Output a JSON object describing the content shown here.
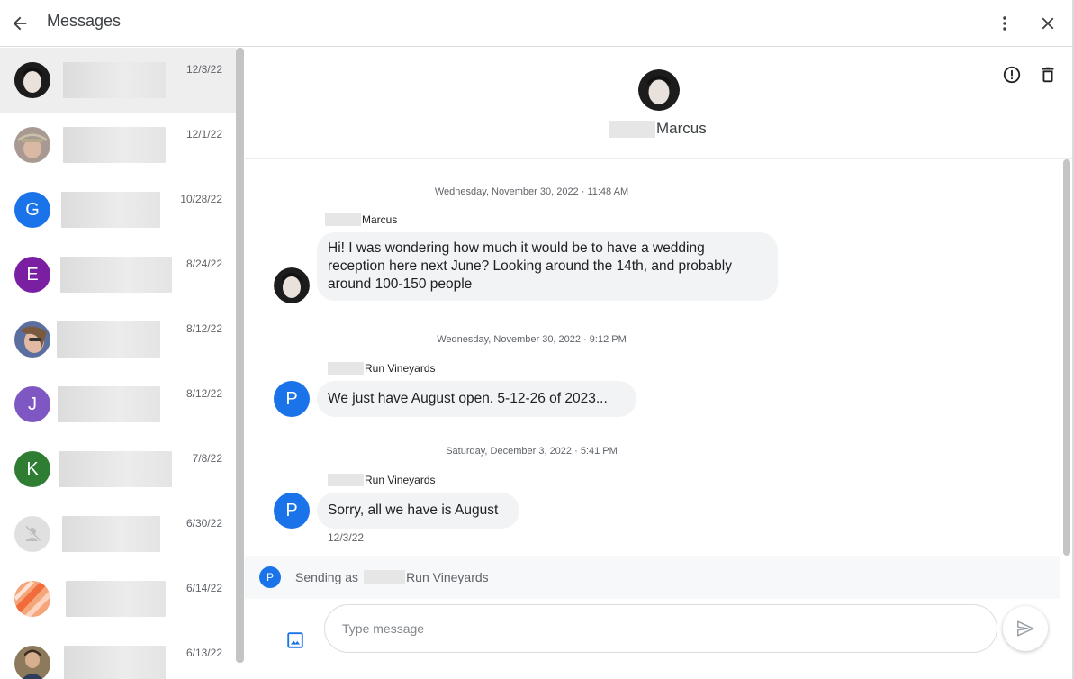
{
  "header": {
    "title": "Messages"
  },
  "conversations": [
    {
      "avatar": "photo",
      "date": "12/3/22",
      "selected": true
    },
    {
      "avatar": "photo",
      "date": "12/1/22"
    },
    {
      "avatar": "letter",
      "letter": "G",
      "color": "#1a73e8",
      "date": "10/28/22"
    },
    {
      "avatar": "letter",
      "letter": "E",
      "color": "#7b1fa2",
      "date": "8/24/22"
    },
    {
      "avatar": "photo",
      "date": "8/12/22"
    },
    {
      "avatar": "letter",
      "letter": "J",
      "color": "#7e57c2",
      "date": "8/12/22"
    },
    {
      "avatar": "letter",
      "letter": "K",
      "color": "#2e7d32",
      "date": "7/8/22"
    },
    {
      "avatar": "default",
      "date": "6/30/22"
    },
    {
      "avatar": "photo",
      "date": "6/14/22"
    },
    {
      "avatar": "photo",
      "date": "6/13/22"
    }
  ],
  "thread": {
    "contact_name": "Marcus",
    "messages": [
      {
        "timestamp": "Wednesday, November 30, 2022 · 11:48 AM",
        "sender": "Marcus",
        "lines": [
          "Hi! I was wondering how much it would be to have a wedding",
          "reception here next June? Looking around the 14th, and probably",
          "around 100-150 people"
        ]
      },
      {
        "timestamp": "Wednesday, November 30, 2022 · 9:12 PM",
        "sender": "Run Vineyards",
        "avatar_letter": "P",
        "lines": [
          "We just have August open. 5-12-26 of 2023..."
        ]
      },
      {
        "timestamp": "Saturday, December 3, 2022 · 5:41 PM",
        "sender": "Run Vineyards",
        "avatar_letter": "P",
        "lines": [
          "Sorry, all we have is August"
        ],
        "date_below": "12/3/22"
      }
    ],
    "sending_as": {
      "prefix": "Sending as",
      "name": "Run Vineyards",
      "avatar_letter": "P"
    },
    "composer": {
      "placeholder": "Type message"
    }
  },
  "colors": {
    "accent": "#1a73e8",
    "bubble": "#f1f3f4"
  }
}
